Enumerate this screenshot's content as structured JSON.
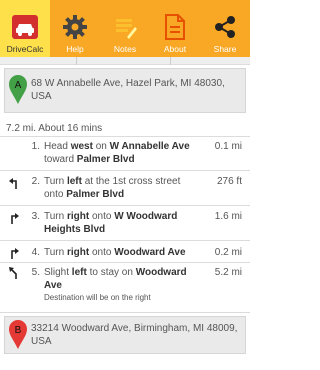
{
  "toolbar": {
    "drivecalc": "DriveCalc",
    "help": "Help",
    "notes": "Notes",
    "about": "About",
    "share": "Share",
    "colors": {
      "bar": "#f9a825",
      "active": "#fde04a"
    }
  },
  "origin": {
    "marker": "A",
    "address": "68 W Annabelle Ave, Hazel Park, MI 48030, USA",
    "pin_color": "#43a047"
  },
  "summary": "7.2 mi. About 16 mins",
  "steps": [
    {
      "num": "1.",
      "pre": "Head ",
      "b1": "west",
      "mid": " on ",
      "b2": "W Annabelle Ave",
      "post": " toward ",
      "b3": "Palmer Blvd",
      "dist": "0.1 mi",
      "icon": "none"
    },
    {
      "num": "2.",
      "pre": "Turn ",
      "b1": "left",
      "mid": " at the 1st cross street onto ",
      "b2": "Palmer Blvd",
      "dist": "276 ft",
      "icon": "turn-left-icon"
    },
    {
      "num": "3.",
      "pre": "Turn ",
      "b1": "right",
      "mid": " onto ",
      "b2": "W Woodward Heights Blvd",
      "dist": "1.6 mi",
      "icon": "turn-right-icon"
    },
    {
      "num": "4.",
      "pre": "Turn ",
      "b1": "right",
      "mid": " onto ",
      "b2": "Woodward Ave",
      "dist": "0.2 mi",
      "icon": "turn-right-icon"
    },
    {
      "num": "5.",
      "pre": "Slight ",
      "b1": "left",
      "mid": " to stay on ",
      "b2": "Woodward Ave",
      "note": "Destination will be on the right",
      "dist": "5.2 mi",
      "icon": "slight-left-icon"
    }
  ],
  "destination": {
    "marker": "B",
    "address": "33214 Woodward Ave, Birmingham, MI 48009, USA",
    "pin_color": "#e53935"
  }
}
